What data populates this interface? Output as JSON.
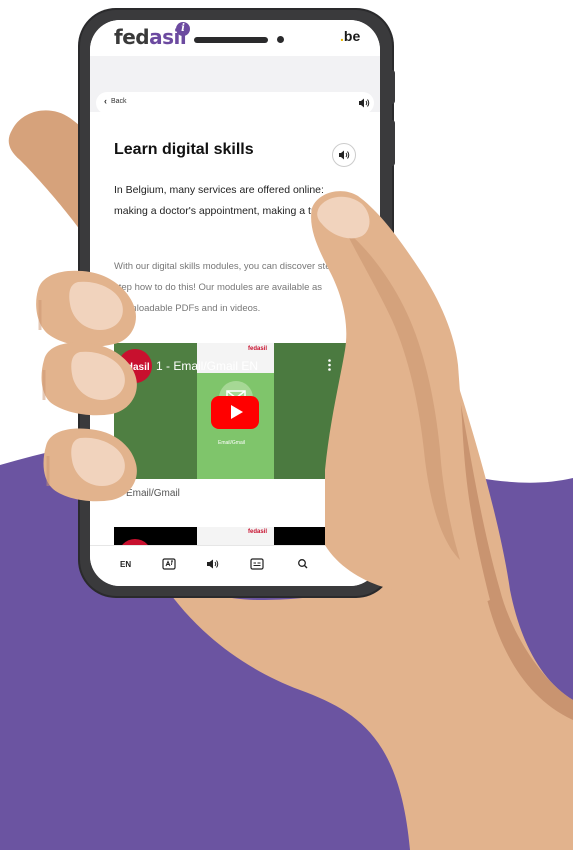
{
  "header": {
    "logo_fed": "fed",
    "logo_asil": "asil",
    "info_badge": "i",
    "gov_logo_be": "be",
    "gov_logo_dot": "."
  },
  "nav": {
    "back_label": "Back",
    "expand_icon": "chevron-down-icon",
    "read_aloud_icon": "speaker-icon"
  },
  "page": {
    "title": "Learn digital skills",
    "intro": "In Belgium, many services are offered online: making a doctor's appointment, making a transfer...",
    "body": "With our digital skills modules, you can discover step by step how to do this! Our modules are available as downloadable PDFs and in videos."
  },
  "video1": {
    "channel_avatar_text": "fedasil",
    "title": "1 - Email/Gmail EN",
    "thumbnail_logo": "fedasil",
    "thumbnail_caption": "Email/Gmail",
    "caption": "Email/Gmail"
  },
  "video2": {
    "thumbnail_logo": "fedasil"
  },
  "toolbar": {
    "language": "EN",
    "icons": [
      "translate-icon",
      "speaker-icon",
      "subtitles-icon",
      "search-icon"
    ]
  },
  "colors": {
    "brand_purple": "#6c4aa0",
    "background_purple": "#6b54a1",
    "youtube_red": "#ff0000",
    "skin": "#e2b38d",
    "skin_shadow": "#c99470",
    "phone_frame": "#3a3a3c"
  }
}
